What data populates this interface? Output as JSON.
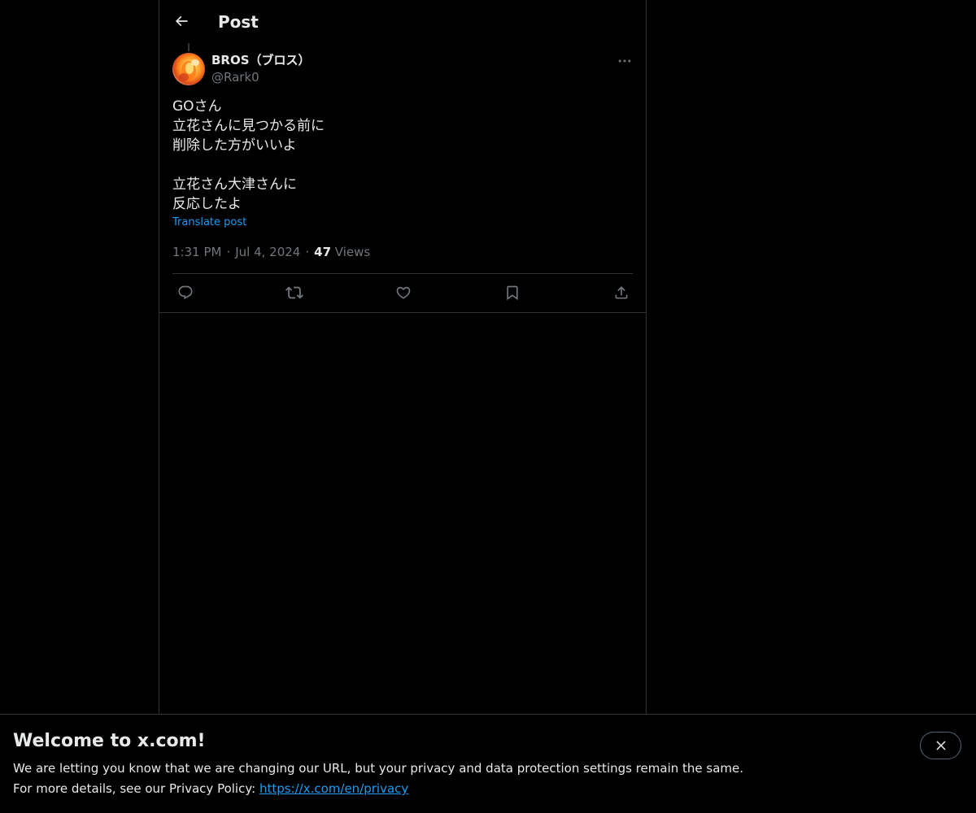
{
  "header": {
    "title": "Post"
  },
  "post": {
    "author_name": "BROS（ブロス）",
    "author_handle": "@Rark0",
    "lines": [
      "GOさん",
      "立花さんに見つかる前に",
      "削除した方がいいよ",
      "",
      "立花さん大津さんに",
      "反応したよ"
    ],
    "translate_label": "Translate post",
    "time": "1:31 PM",
    "date": "Jul 4, 2024",
    "views_count": "47",
    "views_label": "Views",
    "separator": "·"
  },
  "actions": [
    {
      "name": "reply",
      "icon": "reply-icon"
    },
    {
      "name": "repost",
      "icon": "repost-icon"
    },
    {
      "name": "like",
      "icon": "heart-icon"
    },
    {
      "name": "bookmark",
      "icon": "bookmark-icon"
    },
    {
      "name": "share",
      "icon": "share-icon"
    }
  ],
  "banner": {
    "title": "Welcome to x.com!",
    "line1": "We are letting you know that we are changing our URL, but your privacy and data protection settings remain the same.",
    "line2_prefix": "For more details, see our Privacy Policy: ",
    "privacy_link": "https://x.com/en/privacy"
  },
  "colors": {
    "background": "#000000",
    "text_primary": "#e7e9ea",
    "text_secondary": "#71767b",
    "accent": "#1d9bf0",
    "border": "#2f3336"
  }
}
